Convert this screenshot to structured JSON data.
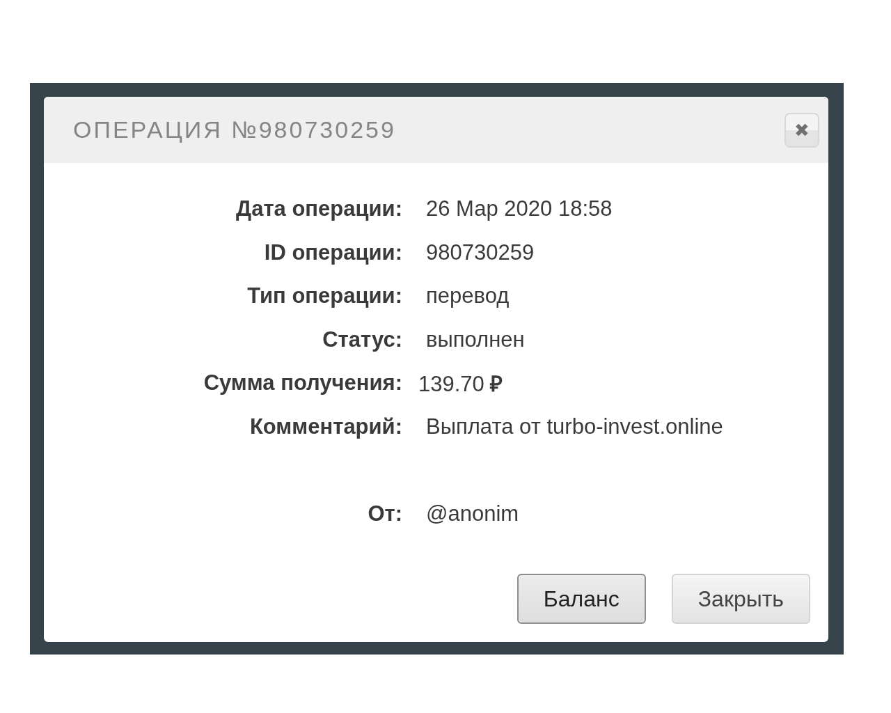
{
  "dialog": {
    "title": "ОПЕРАЦИЯ №980730259",
    "close_icon": "✖"
  },
  "details": [
    {
      "kind": "detail",
      "label": "Дата операции:",
      "value": "26 Мар 2020 18:58"
    },
    {
      "kind": "detail",
      "label": "ID операции:",
      "value": "980730259"
    },
    {
      "kind": "detail",
      "label": "Тип операции:",
      "value": "перевод"
    },
    {
      "kind": "detail",
      "label": "Статус:",
      "value": "выполнен"
    },
    {
      "kind": "amount",
      "label": "Сумма получения:",
      "value": "139.70 **₽**"
    },
    {
      "kind": "detail",
      "label": "Комментарий:",
      "value": "Выплата от turbo-invest.online"
    },
    {
      "kind": "sender",
      "label": "От:",
      "value": "@anonim"
    }
  ],
  "buttons": [
    {
      "label": "Баланс",
      "focused": true
    },
    {
      "label": "Закрыть",
      "focused": false
    }
  ]
}
